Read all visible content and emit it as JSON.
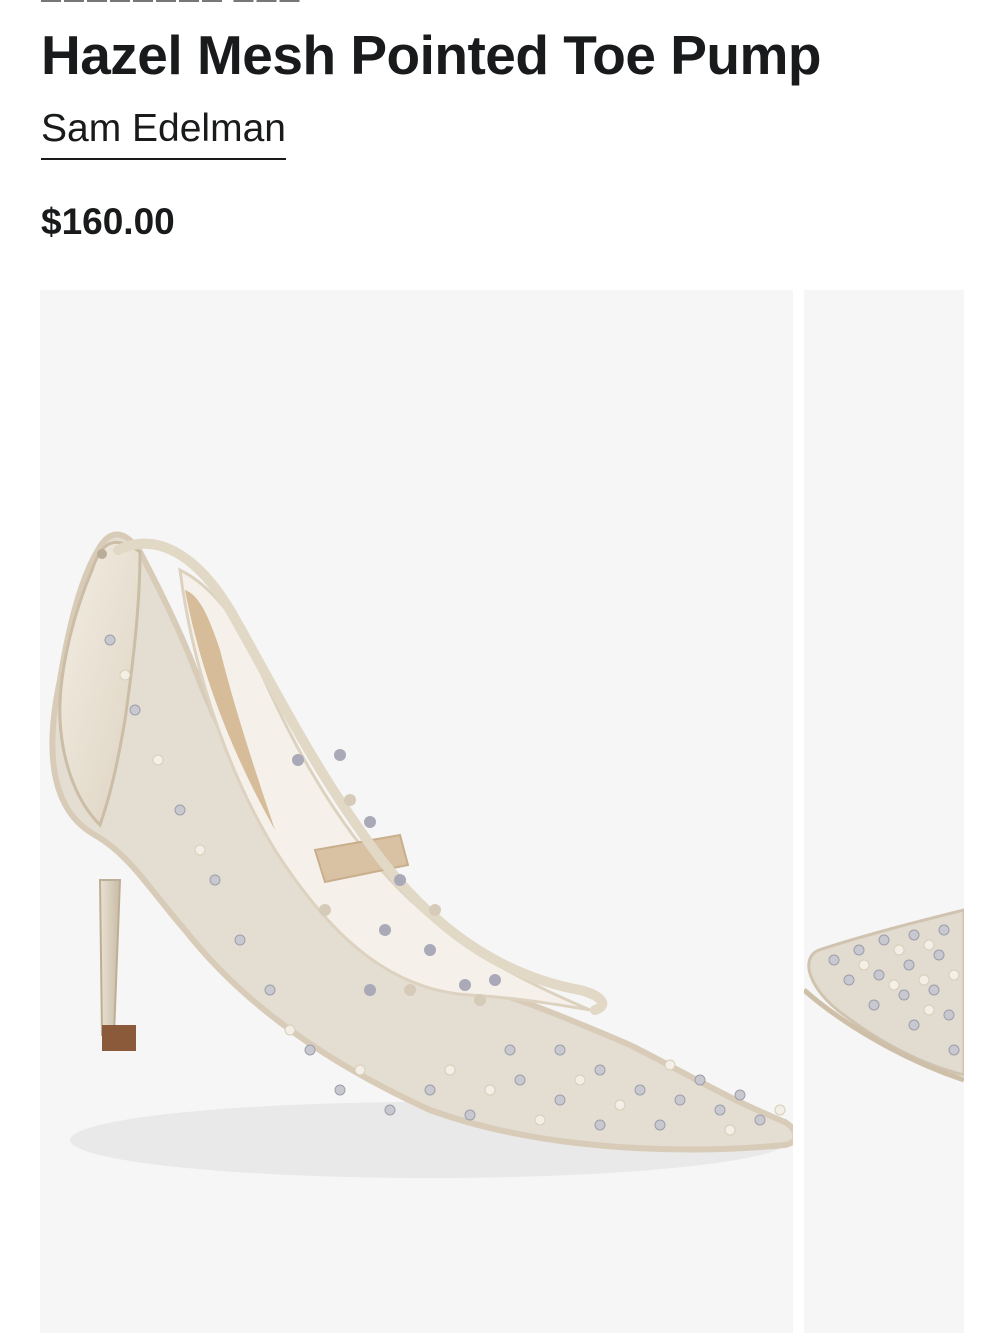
{
  "product": {
    "title": "Hazel Mesh Pointed Toe Pump",
    "brand": "Sam Edelman",
    "price": "$160.00"
  },
  "gallery": {
    "images": [
      {
        "alt": "Hazel Mesh Pointed Toe Pump"
      },
      {
        "alt": "Hazel Mesh Pointed Toe Pump"
      }
    ]
  },
  "colors": {
    "text": "#191a1b",
    "image_bg": "#f6f6f6",
    "shoe_leather": "#ece4d6",
    "mesh": "#e4ddd2",
    "heel_base": "#8a5a3a"
  }
}
